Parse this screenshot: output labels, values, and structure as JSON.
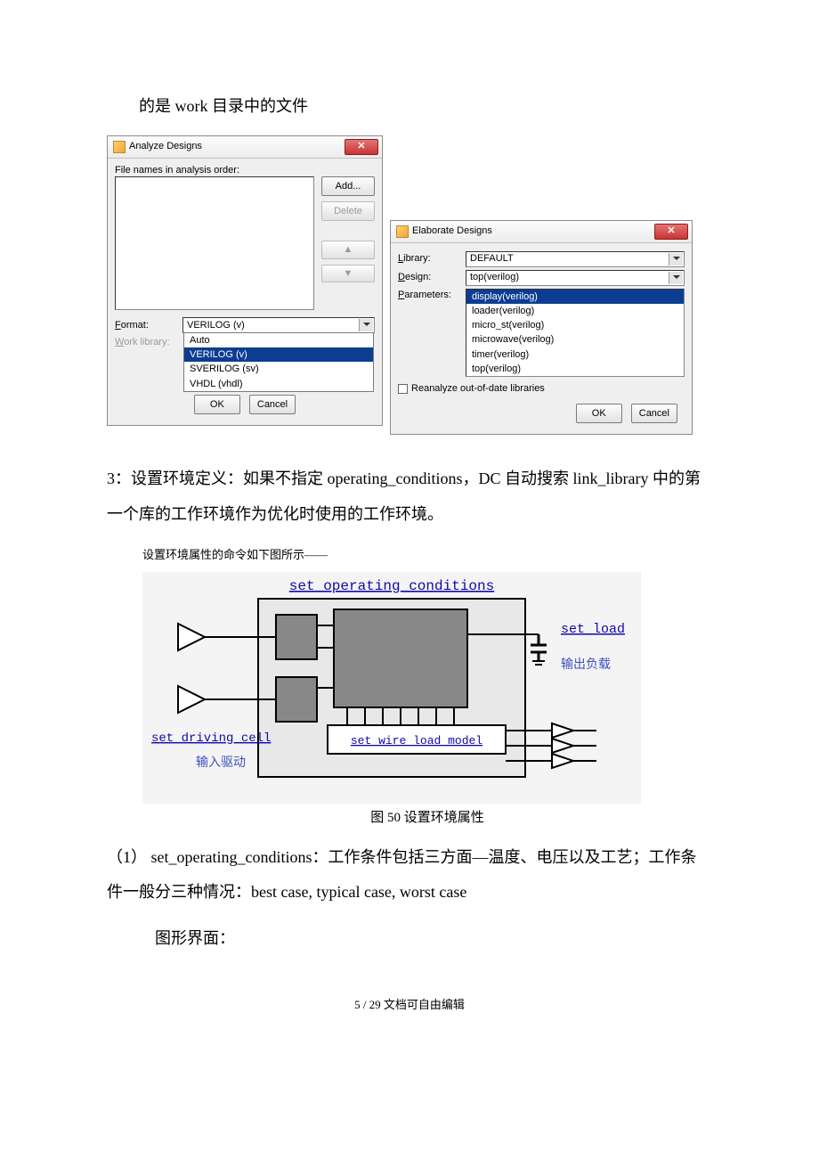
{
  "intro_line": "的是 work 目录中的文件",
  "analyze": {
    "title": "Analyze Designs",
    "list_header": "File names in analysis order:",
    "add_btn": "Add...",
    "delete_btn": "Delete",
    "format_label": "Format:",
    "format_value": "VERILOG (v)",
    "worklib_label": "Work library:",
    "format_options": [
      "Auto",
      "VERILOG (v)",
      "SVERILOG (sv)",
      "VHDL (vhdl)"
    ],
    "ok": "OK",
    "cancel": "Cancel"
  },
  "elaborate": {
    "title": "Elaborate Designs",
    "library_label": "Library:",
    "library_value": "DEFAULT",
    "design_label": "Design:",
    "design_value": "top(verilog)",
    "params_label": "Parameters:",
    "params_options": [
      "display(verilog)",
      "loader(verilog)",
      "micro_st(verilog)",
      "microwave(verilog)",
      "timer(verilog)",
      "top(verilog)"
    ],
    "reanalyze": "Reanalyze out-of-date libraries",
    "ok": "OK",
    "cancel": "Cancel"
  },
  "para3": "3：设置环境定义：如果不指定 operating_conditions，DC 自动搜索 link_library 中的第一个库的工作环境作为优化时使用的工作环境。",
  "diagram_intro": "设置环境属性的命令如下图所示——",
  "chart_data": {
    "type": "diagram",
    "title": "图 50  设置环境属性",
    "labels": {
      "top": "set_operating_conditions",
      "right_top": "set_load",
      "right_top_cn": "输出负载",
      "left_mid": "set_driving_cell",
      "left_mid_cn": "输入驱动",
      "inner_box": "set_wire_load_model"
    }
  },
  "para4": "（1） set_operating_conditions：工作条件包括三方面—温度、电压以及工艺；工作条件一般分三种情况：best case, typical case, worst case",
  "para5": "图形界面：",
  "footer": "5 / 29 文档可自由编辑"
}
